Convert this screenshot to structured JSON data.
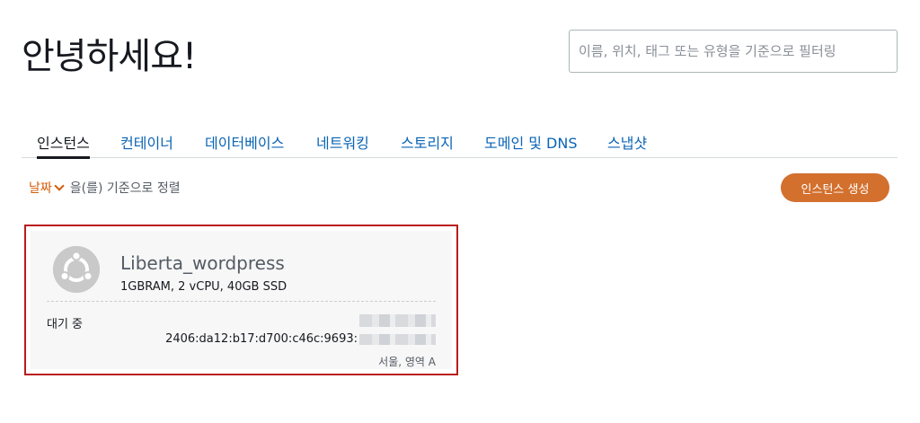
{
  "greeting": "안녕하세요!",
  "search": {
    "placeholder": "이름, 위치, 태그 또는 유형을 기준으로 필터링"
  },
  "tabs": [
    {
      "label": "인스턴스"
    },
    {
      "label": "컨테이너"
    },
    {
      "label": "데이터베이스"
    },
    {
      "label": "네트워킹"
    },
    {
      "label": "스토리지"
    },
    {
      "label": "도메인 및 DNS"
    },
    {
      "label": "스냅샷"
    }
  ],
  "sort": {
    "field": "날짜",
    "suffix": "을(를) 기준으로 정렬"
  },
  "create_button": "인스턴스 생성",
  "instance": {
    "name": "Liberta_wordpress",
    "spec": "1GBRAM, 2 vCPU, 40GB SSD",
    "status": "대기 중",
    "ipv6_prefix": "2406:da12:b17:d700:c46c:9693:",
    "region": "서울, 영역 A"
  },
  "colors": {
    "accent": "#d3702e",
    "link": "#0a64b5",
    "highlight_border": "#b91c1c"
  }
}
